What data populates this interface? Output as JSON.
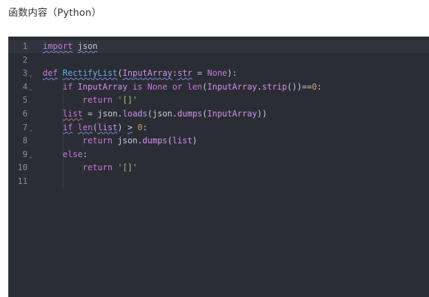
{
  "page": {
    "title": "函数内容（Python）"
  },
  "editor": {
    "active_line": 1,
    "lines": [
      {
        "no": "1",
        "fold": "",
        "html": "<span class=\"kw sq\">import</span> <span class=\"id sq\">json</span>"
      },
      {
        "no": "2",
        "fold": "",
        "html": ""
      },
      {
        "no": "3",
        "fold": "⌄",
        "html": "<span class=\"kw sq\">def</span> <span class=\"fn sq\">RectifyList</span>(<span class=\"kw2 sq\">InputArray</span>:<span class=\"kw2 sq\">str</span> = <span class=\"kw\">None</span>):"
      },
      {
        "no": "4",
        "fold": "⌄",
        "html": "    <span class=\"kw\">if</span> <span class=\"kw2\">InputArray</span> <span class=\"kw\">is</span> <span class=\"kw\">None</span> <span class=\"kw\">or</span> <span class=\"kw\">len</span>(<span class=\"kw2\">InputArray</span>.<span class=\"kw2\">strip</span>())==<span class=\"num\">0</span>:"
      },
      {
        "no": "5",
        "fold": "",
        "html": "        <span class=\"kw\">return</span> <span class=\"str\">'[]'</span>"
      },
      {
        "no": "6",
        "fold": "",
        "html": "    <span class=\"kw sqr\">list</span> = <span class=\"id\">json</span>.<span class=\"kw2\">loads</span>(<span class=\"id\">json</span>.<span class=\"kw2\">dumps</span>(<span class=\"kw2\">InputArray</span>))"
      },
      {
        "no": "7",
        "fold": "⌄",
        "html": "    <span class=\"kw sq\">if</span> <span class=\"kw sq\">len</span>(<span class=\"kw2 sq\">list</span>) <span class=\"sq\">&gt;</span> <span class=\"num\">0</span>:"
      },
      {
        "no": "8",
        "fold": "",
        "html": "        <span class=\"kw\">return</span> <span class=\"id\">json</span>.<span class=\"kw2\">dumps</span>(<span class=\"kw2\">list</span>)"
      },
      {
        "no": "9",
        "fold": "⌄",
        "html": "    <span class=\"kw\">else</span>:"
      },
      {
        "no": "10",
        "fold": "",
        "html": "        <span class=\"kw\">return</span> <span class=\"str\">'[]'</span>"
      },
      {
        "no": "11",
        "fold": "",
        "html": ""
      }
    ]
  },
  "colors": {
    "editor_bg": "#2b2d35",
    "keyword": "#c678dd",
    "function": "#61afef",
    "string": "#98c379",
    "number": "#d19a66"
  }
}
